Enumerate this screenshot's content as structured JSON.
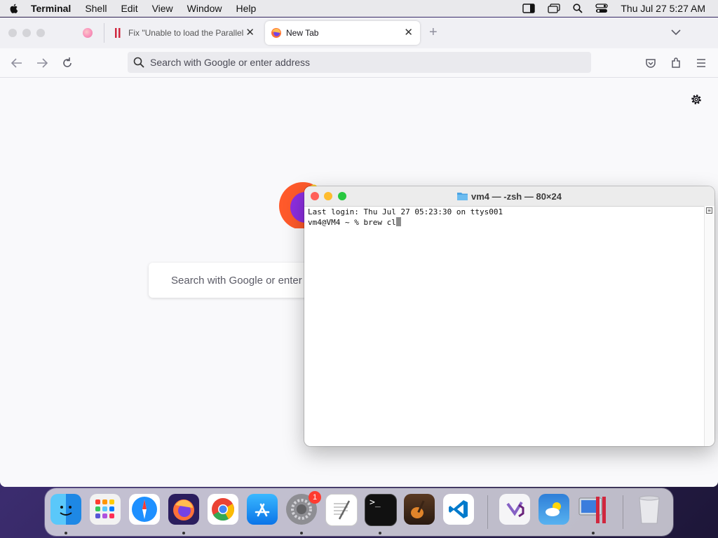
{
  "menubar": {
    "app_name": "Terminal",
    "items": [
      "Shell",
      "Edit",
      "View",
      "Window",
      "Help"
    ],
    "clock": "Thu Jul 27  5:27 AM",
    "status_icons": [
      "sidebar-icon",
      "screen-mirror-icon",
      "search-icon",
      "control-center-icon"
    ]
  },
  "browser": {
    "tabs": [
      {
        "label": "Fix \"Unable to load the Parallels",
        "icon": "parallels-icon",
        "active": false
      },
      {
        "label": "New Tab",
        "icon": "firefox-icon",
        "active": true
      }
    ],
    "url_placeholder": "Search with Google or enter address",
    "search_placeholder": "Search with Google or enter address"
  },
  "terminal": {
    "title": "vm4 — -zsh — 80×24",
    "lines": [
      "Last login: Thu Jul 27 05:23:30 on ttys001",
      "vm4@VM4 ~ % brew cl"
    ]
  },
  "dock": {
    "apps": [
      "Finder",
      "Launchpad",
      "Safari",
      "Firefox",
      "Google Chrome",
      "App Store",
      "System Settings",
      "TextEdit",
      "Terminal",
      "GarageBand",
      "Visual Studio Code",
      "Visual Studio",
      "Weather",
      "Parallels Desktop",
      "Trash"
    ],
    "settings_badge": "1"
  },
  "colors": {
    "close": "#ff5f57",
    "minimize": "#febc2e",
    "zoom": "#28c840",
    "firefox_bg": "#f9f9fb",
    "menubar_bg": "#e9e9ec"
  }
}
